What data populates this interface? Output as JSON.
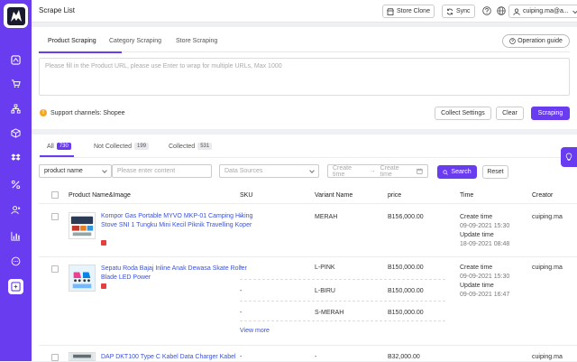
{
  "app": {
    "page_title": "Scrape List"
  },
  "topbar": {
    "store_clone": "Store Clone",
    "sync": "Sync",
    "account": "cuiping.ma@a..."
  },
  "tabs": [
    "Product Scraping",
    "Category Scraping",
    "Store Scraping"
  ],
  "operation_guide": "Operation guide",
  "url_input": {
    "placeholder": "Please fill in the Product URL, please use Enter to wrap for multiple URLs, Max 1000"
  },
  "support": "Support channels: Shopee",
  "buttons": {
    "collect_settings": "Collect Settings",
    "clear": "Clear",
    "scraping": "Scraping",
    "search": "Search",
    "reset": "Reset"
  },
  "sub_tabs": [
    {
      "label": "All",
      "count": "730"
    },
    {
      "label": "Not Collected",
      "count": "199"
    },
    {
      "label": "Collected",
      "count": "531"
    }
  ],
  "filters": {
    "search_type": "product name",
    "search_placeholder": "Please enter content",
    "data_source_placeholder": "Data Sources",
    "create_time_start": "Create time",
    "create_time_sep": "→",
    "create_time_end": "Create time"
  },
  "table": {
    "headers": [
      "Product Name&Image",
      "SKU",
      "Variant Name",
      "price",
      "Time",
      "Creator"
    ],
    "rows": [
      {
        "name": "Kompor Gas Portable MYVO MKP-01 Camping Hiking Stove SNI 1 Tungku Mini Kecil Piknik Travelling Koper",
        "variants": [
          {
            "sku": "-",
            "variant": "MERAH",
            "price": "B156,000.00"
          }
        ],
        "create_label": "Create time",
        "create_time": "09-09-2021 15:30",
        "update_label": "Update time",
        "update_time": "18-09-2021 08:48",
        "creator": "cuiping.ma"
      },
      {
        "name": "Sepatu Roda Bajaj Inline Anak Dewasa Skate Roller Blade LED Power",
        "variants": [
          {
            "sku": "-",
            "variant": "L-PINK",
            "price": "B150,000.00"
          },
          {
            "sku": "-",
            "variant": "L-BIRU",
            "price": "B150,000.00"
          },
          {
            "sku": "-",
            "variant": "S-MERAH",
            "price": "B150,000.00"
          }
        ],
        "create_label": "Create time",
        "create_time": "09-09-2021 15:30",
        "update_label": "Update time",
        "update_time": "09-09-2021 16:47",
        "creator": "cuiping.ma",
        "view_more": "View more"
      },
      {
        "name": "DAP DKT100 Type C Kabel Data Charger Kabel",
        "variants": [
          {
            "sku": "-",
            "variant": "-",
            "price": "B32,000.00"
          }
        ],
        "creator": "cuiping.ma"
      }
    ]
  },
  "colors": {
    "accent": "#6a3cf0",
    "link": "#3b52d6",
    "warning": "#f5a623"
  }
}
